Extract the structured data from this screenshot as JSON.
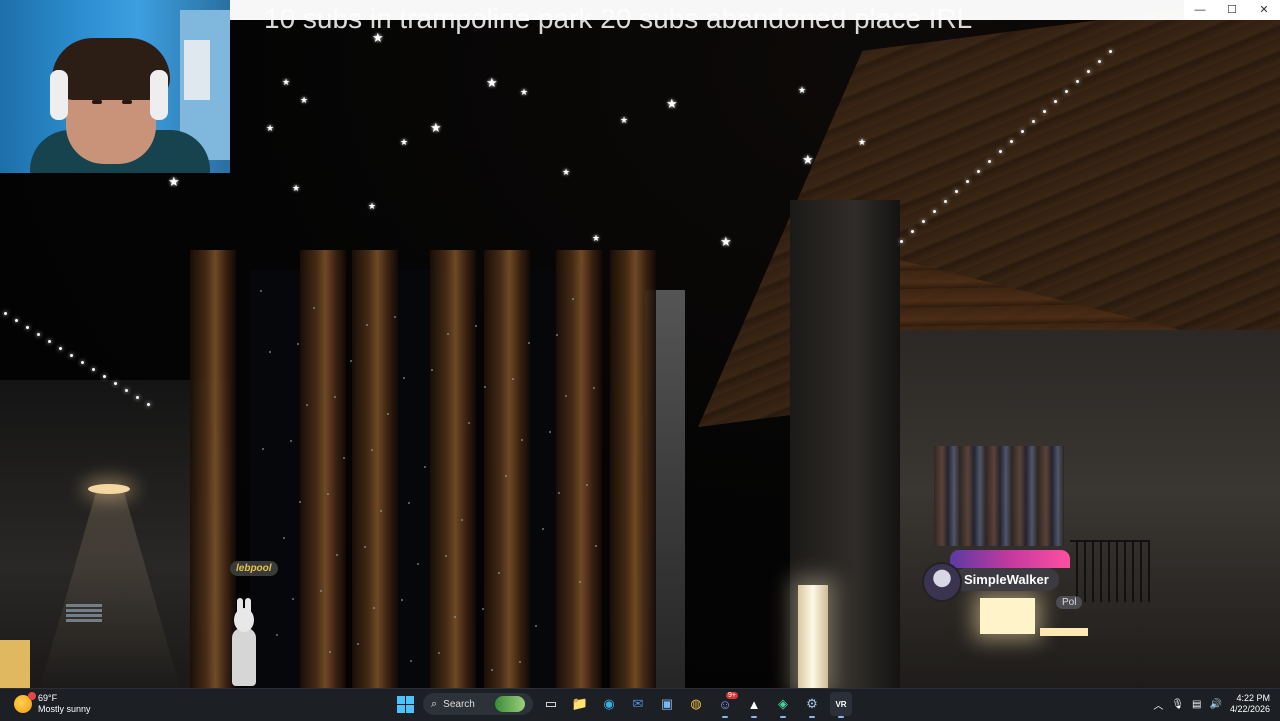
{
  "stream_overlay": {
    "title": "10 subs in trampoline park 20 subs abandoned place IRL"
  },
  "game": {
    "players": [
      {
        "name": "lebpool"
      },
      {
        "name": "SimpleWalker",
        "tag": "Pol"
      }
    ]
  },
  "window_controls": {
    "minimize": "—",
    "maximize": "☐",
    "close": "✕"
  },
  "taskbar": {
    "weather": {
      "temp": "69°F",
      "condition": "Mostly sunny"
    },
    "search_label": "Search",
    "apps": [
      {
        "name": "start",
        "icon": "windows-icon"
      },
      {
        "name": "search",
        "icon": "search-icon"
      },
      {
        "name": "task-view",
        "icon": "task-view-icon"
      },
      {
        "name": "file-explorer",
        "icon": "folder-icon",
        "glyph": "📁"
      },
      {
        "name": "edge",
        "icon": "edge-icon",
        "glyph": "◉"
      },
      {
        "name": "outlook",
        "icon": "mail-icon",
        "glyph": "✉"
      },
      {
        "name": "store",
        "icon": "store-icon",
        "glyph": "▣"
      },
      {
        "name": "chrome",
        "icon": "chrome-icon",
        "glyph": "◍"
      },
      {
        "name": "discord",
        "icon": "discord-icon",
        "glyph": "☺",
        "badge": "9+"
      },
      {
        "name": "app-m",
        "icon": "app-icon",
        "glyph": "▲"
      },
      {
        "name": "app-green",
        "icon": "app-icon",
        "glyph": "◈"
      },
      {
        "name": "steam",
        "icon": "steam-icon",
        "glyph": "⚙"
      },
      {
        "name": "vrchat",
        "icon": "vrchat-icon",
        "glyph": "VR"
      }
    ],
    "tray": {
      "time": "4:22 PM",
      "date": "4/22/2026"
    }
  },
  "colors": {
    "accent": "#4cc2ff",
    "taskbar_bg": "#1c1f24"
  }
}
